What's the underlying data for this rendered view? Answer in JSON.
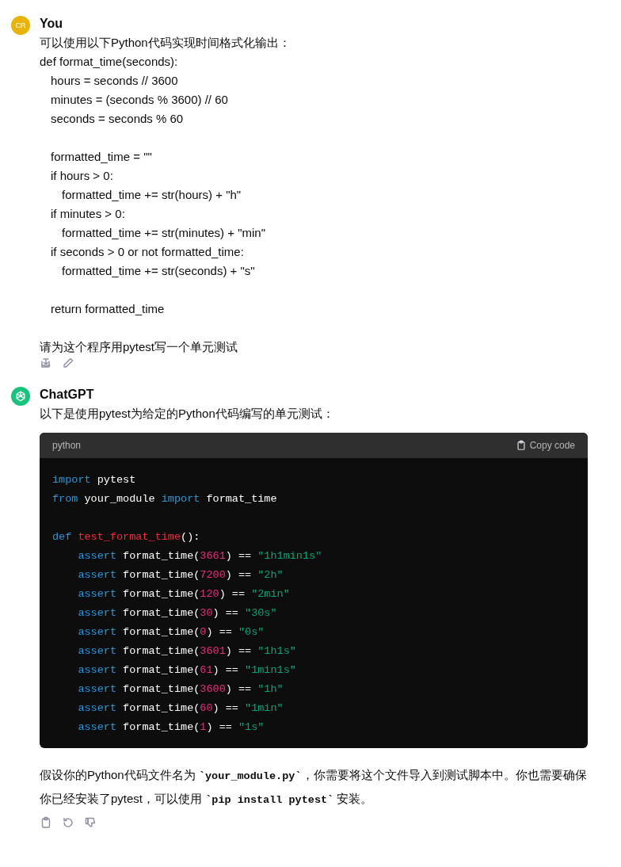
{
  "messages": [
    {
      "author": "You",
      "avatar_initials": "CR",
      "kind": "user",
      "lines": [
        {
          "text": "可以使用以下Python代码实现时间格式化输出："
        },
        {
          "text": "def format_time(seconds):",
          "children": [
            {
              "text": "hours = seconds // 3600"
            },
            {
              "text": "minutes = (seconds % 3600) // 60"
            },
            {
              "text": "seconds = seconds % 60"
            },
            {
              "text": "formatted_time = \"\"",
              "space_before": true
            },
            {
              "text": "if hours > 0:",
              "children": [
                {
                  "text": "formatted_time += str(hours) + \"h\""
                }
              ]
            },
            {
              "text": "if minutes > 0:",
              "children": [
                {
                  "text": "formatted_time += str(minutes) + \"min\""
                }
              ]
            },
            {
              "text": "if seconds > 0 or not formatted_time:",
              "children": [
                {
                  "text": "formatted_time += str(seconds) + \"s\""
                }
              ]
            },
            {
              "text": "return formatted_time",
              "space_before": true
            }
          ]
        },
        {
          "text": "请为这个程序用pytest写一个单元测试",
          "space_before": true
        }
      ],
      "actions": [
        {
          "kind": "save"
        },
        {
          "kind": "edit"
        }
      ]
    },
    {
      "author": "ChatGPT",
      "kind": "assistant",
      "intro": "以下是使用pytest为给定的Python代码编写的单元测试：",
      "code": {
        "language": "python",
        "copy_label": "Copy code",
        "lines": [
          {
            "tokens": [
              {
                "kind": "kw",
                "t": "import"
              },
              {
                "kind": "plain",
                "t": " pytest"
              }
            ]
          },
          {
            "tokens": [
              {
                "kind": "kw",
                "t": "from"
              },
              {
                "kind": "plain",
                "t": " your_module "
              },
              {
                "kind": "kw",
                "t": "import"
              },
              {
                "kind": "plain",
                "t": " format_time"
              }
            ]
          },
          {
            "space_before": true,
            "tokens": [
              {
                "kind": "kw",
                "t": "def"
              },
              {
                "kind": "fn",
                "t": " test_format_time"
              },
              {
                "kind": "plain",
                "t": "():"
              }
            ]
          },
          {
            "tokens": [
              {
                "kind": "kw",
                "t": "    assert"
              },
              {
                "kind": "plain",
                "t": " format_time("
              },
              {
                "kind": "num",
                "t": "3661"
              },
              {
                "kind": "plain",
                "t": ") == "
              },
              {
                "kind": "str",
                "t": "\"1h1min1s\""
              }
            ]
          },
          {
            "tokens": [
              {
                "kind": "kw",
                "t": "    assert"
              },
              {
                "kind": "plain",
                "t": " format_time("
              },
              {
                "kind": "num",
                "t": "7200"
              },
              {
                "kind": "plain",
                "t": ") == "
              },
              {
                "kind": "str",
                "t": "\"2h\""
              }
            ]
          },
          {
            "tokens": [
              {
                "kind": "kw",
                "t": "    assert"
              },
              {
                "kind": "plain",
                "t": " format_time("
              },
              {
                "kind": "num",
                "t": "120"
              },
              {
                "kind": "plain",
                "t": ") == "
              },
              {
                "kind": "str",
                "t": "\"2min\""
              }
            ]
          },
          {
            "tokens": [
              {
                "kind": "kw",
                "t": "    assert"
              },
              {
                "kind": "plain",
                "t": " format_time("
              },
              {
                "kind": "num",
                "t": "30"
              },
              {
                "kind": "plain",
                "t": ") == "
              },
              {
                "kind": "str",
                "t": "\"30s\""
              }
            ]
          },
          {
            "tokens": [
              {
                "kind": "kw",
                "t": "    assert"
              },
              {
                "kind": "plain",
                "t": " format_time("
              },
              {
                "kind": "num",
                "t": "0"
              },
              {
                "kind": "plain",
                "t": ") == "
              },
              {
                "kind": "str",
                "t": "\"0s\""
              }
            ]
          },
          {
            "tokens": [
              {
                "kind": "kw",
                "t": "    assert"
              },
              {
                "kind": "plain",
                "t": " format_time("
              },
              {
                "kind": "num",
                "t": "3601"
              },
              {
                "kind": "plain",
                "t": ") == "
              },
              {
                "kind": "str",
                "t": "\"1h1s\""
              }
            ]
          },
          {
            "tokens": [
              {
                "kind": "kw",
                "t": "    assert"
              },
              {
                "kind": "plain",
                "t": " format_time("
              },
              {
                "kind": "num",
                "t": "61"
              },
              {
                "kind": "plain",
                "t": ") == "
              },
              {
                "kind": "str",
                "t": "\"1min1s\""
              }
            ]
          },
          {
            "tokens": [
              {
                "kind": "kw",
                "t": "    assert"
              },
              {
                "kind": "plain",
                "t": " format_time("
              },
              {
                "kind": "num",
                "t": "3600"
              },
              {
                "kind": "plain",
                "t": ") == "
              },
              {
                "kind": "str",
                "t": "\"1h\""
              }
            ]
          },
          {
            "tokens": [
              {
                "kind": "kw",
                "t": "    assert"
              },
              {
                "kind": "plain",
                "t": " format_time("
              },
              {
                "kind": "num",
                "t": "60"
              },
              {
                "kind": "plain",
                "t": ") == "
              },
              {
                "kind": "str",
                "t": "\"1min\""
              }
            ]
          },
          {
            "tokens": [
              {
                "kind": "kw",
                "t": "    assert"
              },
              {
                "kind": "plain",
                "t": " format_time("
              },
              {
                "kind": "num",
                "t": "1"
              },
              {
                "kind": "plain",
                "t": ") == "
              },
              {
                "kind": "str",
                "t": "\"1s\""
              }
            ]
          }
        ]
      },
      "outro": [
        {
          "kind": "text",
          "t": "假设你的Python代码文件名为 "
        },
        {
          "kind": "code",
          "t": "`your_module.py`"
        },
        {
          "kind": "text",
          "t": "，你需要将这个文件导入到测试脚本中。你也需要确保你已经安装了pytest，可以使用 "
        },
        {
          "kind": "code",
          "t": "`pip install pytest`"
        },
        {
          "kind": "text",
          "t": " 安装。"
        }
      ],
      "actions": [
        {
          "kind": "copy"
        },
        {
          "kind": "regenerate"
        },
        {
          "kind": "thumbs_down"
        }
      ]
    }
  ]
}
